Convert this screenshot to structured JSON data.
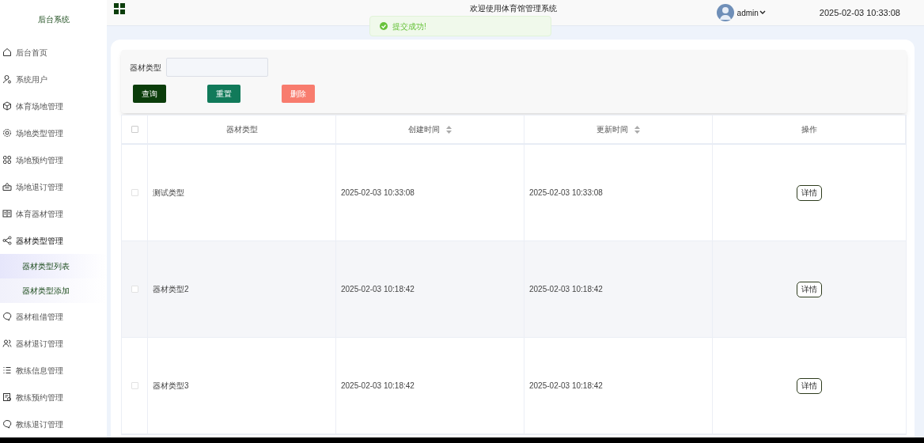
{
  "sidebar": {
    "title": "后台系统",
    "items": [
      {
        "label": "后台首页",
        "kind": "home",
        "expanded": false
      },
      {
        "label": "系统用户",
        "kind": "user",
        "expanded": false
      },
      {
        "label": "体育场地管理",
        "kind": "box",
        "expanded": false
      },
      {
        "label": "场地类型管理",
        "kind": "gear",
        "expanded": false
      },
      {
        "label": "场地预约管理",
        "kind": "grid",
        "expanded": false
      },
      {
        "label": "场地退订管理",
        "kind": "inbox",
        "expanded": false
      },
      {
        "label": "体育器材管理",
        "kind": "book",
        "expanded": false
      },
      {
        "label": "器材类型管理",
        "kind": "share",
        "expanded": true,
        "children": [
          {
            "label": "器材类型列表",
            "selected": true
          },
          {
            "label": "器材类型添加",
            "selected": false
          }
        ]
      },
      {
        "label": "器材租借管理",
        "kind": "chat",
        "expanded": false
      },
      {
        "label": "器材退订管理",
        "kind": "users",
        "expanded": false
      },
      {
        "label": "教练信息管理",
        "kind": "list",
        "expanded": false
      },
      {
        "label": "教练预约管理",
        "kind": "form",
        "expanded": false
      },
      {
        "label": "教练退订管理",
        "kind": "chat",
        "expanded": false
      }
    ]
  },
  "header": {
    "title": "欢迎使用体育馆管理系统",
    "user": "admin",
    "datetime": "2025-02-03 10:33:08"
  },
  "toast": {
    "message": "提交成功!"
  },
  "search": {
    "label": "器材类型",
    "buttons": [
      {
        "label": "查询",
        "kind": "query"
      },
      {
        "label": "重置",
        "kind": "reset"
      },
      {
        "label": "删除",
        "kind": "delete"
      }
    ]
  },
  "table": {
    "all_checked": false,
    "columns": [
      {
        "label": "器材类型",
        "sortable": false
      },
      {
        "label": "创建时间",
        "sortable": true
      },
      {
        "label": "更新时间",
        "sortable": true
      },
      {
        "label": "操作",
        "sortable": false
      }
    ],
    "rows": [
      {
        "checked": false,
        "type": "测试类型",
        "created": "2025-02-03 10:33:08",
        "updated": "2025-02-03 10:33:08",
        "action": "详情"
      },
      {
        "checked": false,
        "type": "器材类型2",
        "created": "2025-02-03 10:18:42",
        "updated": "2025-02-03 10:18:42",
        "action": "详情"
      },
      {
        "checked": false,
        "type": "器材类型3",
        "created": "2025-02-03 10:18:42",
        "updated": "2025-02-03 10:18:42",
        "action": "详情"
      }
    ]
  }
}
